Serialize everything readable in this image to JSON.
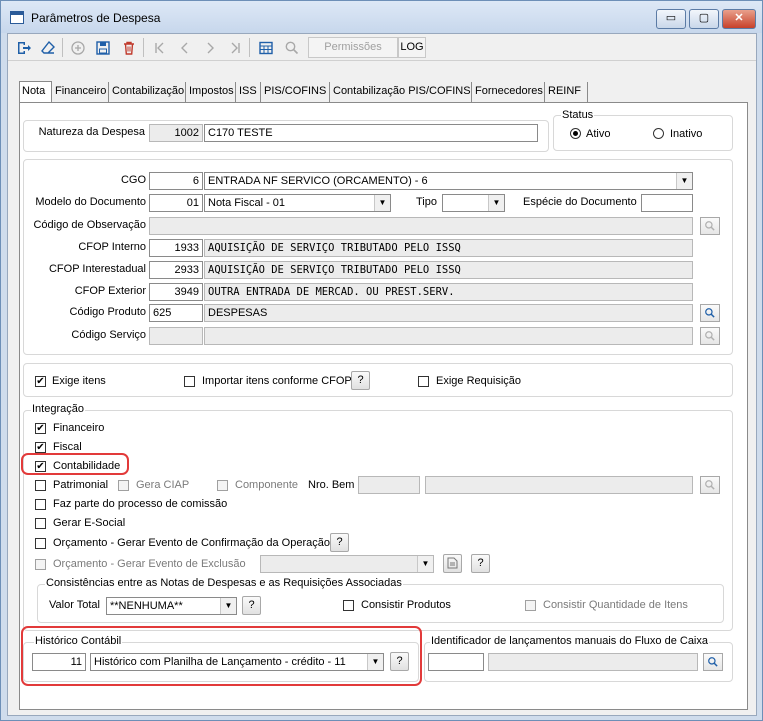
{
  "window": {
    "title": "Parâmetros de Despesa",
    "btn_min": "▭",
    "btn_max": "▢",
    "btn_close": "✕"
  },
  "toolbar": {
    "permissoes": "Permissões",
    "log": "LOG"
  },
  "tabs": [
    "Nota",
    "Financeiro",
    "Contabilização",
    "Impostos",
    "ISS",
    "PIS/COFINS",
    "Contabilização PIS/COFINS",
    "Fornecedores",
    "REINF"
  ],
  "natureza": {
    "label": "Natureza da Despesa",
    "code": "1002",
    "desc": "C170 TESTE"
  },
  "status": {
    "title": "Status",
    "ativo": "Ativo",
    "inativo": "Inativo",
    "selected": "Ativo"
  },
  "doc": {
    "cgo_label": "CGO",
    "cgo_code": "6",
    "cgo_value": "ENTRADA NF SERVICO (ORCAMENTO) - 6",
    "modelo_label": "Modelo do Documento",
    "modelo_code": "01",
    "modelo_value": "Nota Fiscal - 01",
    "tipo_label": "Tipo",
    "tipo_value": "",
    "especie_label": "Espécie do Documento",
    "especie_value": "",
    "obs_label": "Código de Observação",
    "obs_value": "",
    "cfop_int_label": "CFOP Interno",
    "cfop_int_code": "1933",
    "cfop_int_desc": "AQUISIÇÃO DE SERVIÇO TRIBUTADO PELO ISSQ",
    "cfop_inter_label": "CFOP Interestadual",
    "cfop_inter_code": "2933",
    "cfop_inter_desc": "AQUISIÇÃO DE SERVIÇO TRIBUTADO PELO ISSQ",
    "cfop_ext_label": "CFOP Exterior",
    "cfop_ext_code": "3949",
    "cfop_ext_desc": "OUTRA ENTRADA DE MERCAD. OU PREST.SERV.",
    "produto_label": "Código Produto",
    "produto_code": "625",
    "produto_desc": "DESPESAS",
    "servico_label": "Código Serviço",
    "servico_code": "",
    "servico_desc": ""
  },
  "itens": {
    "exige_itens": "Exige itens",
    "importar": "Importar itens conforme CFOP",
    "exige_req": "Exige Requisição"
  },
  "integracao": {
    "title": "Integração",
    "financeiro": "Financeiro",
    "fiscal": "Fiscal",
    "contabilidade": "Contabilidade",
    "patrimonial": "Patrimonial",
    "gera_ciap": "Gera CIAP",
    "componente": "Componente",
    "nro_bem": "Nro. Bem",
    "comissao": "Faz parte do processo de comissão",
    "esocial": "Gerar E-Social",
    "orc_confirm": "Orçamento - Gerar Evento de Confirmação da Operação",
    "orc_exclusao": "Orçamento - Gerar Evento de Exclusão"
  },
  "consistencias": {
    "title": "Consistências entre as Notas de Despesas e as Requisições Associadas",
    "valor_total_label": "Valor Total",
    "valor_total_value": "**NENHUMA**",
    "consistir_produtos": "Consistir Produtos",
    "consistir_qtd": "Consistir Quantidade de Itens"
  },
  "historico": {
    "title": "Histórico Contábil",
    "code": "11",
    "value": "Histórico com Planilha de Lançamento - crédito - 11"
  },
  "fluxo": {
    "title": "Identificador de lançamentos manuais do Fluxo de Caixa",
    "code": "",
    "desc": ""
  },
  "common": {
    "q": "?",
    "check": "✔",
    "down": "▼"
  },
  "colors": {
    "highlight": "#e23a3a",
    "accent": "#1f5fa8"
  },
  "icons": {
    "exit": "exit-icon",
    "clear": "eraser-icon",
    "add": "add-icon",
    "save": "save-icon",
    "delete": "trash-icon",
    "first": "first-icon",
    "prev": "prev-icon",
    "next": "next-icon",
    "last": "last-icon",
    "grid": "grid-icon",
    "search": "search-icon"
  }
}
